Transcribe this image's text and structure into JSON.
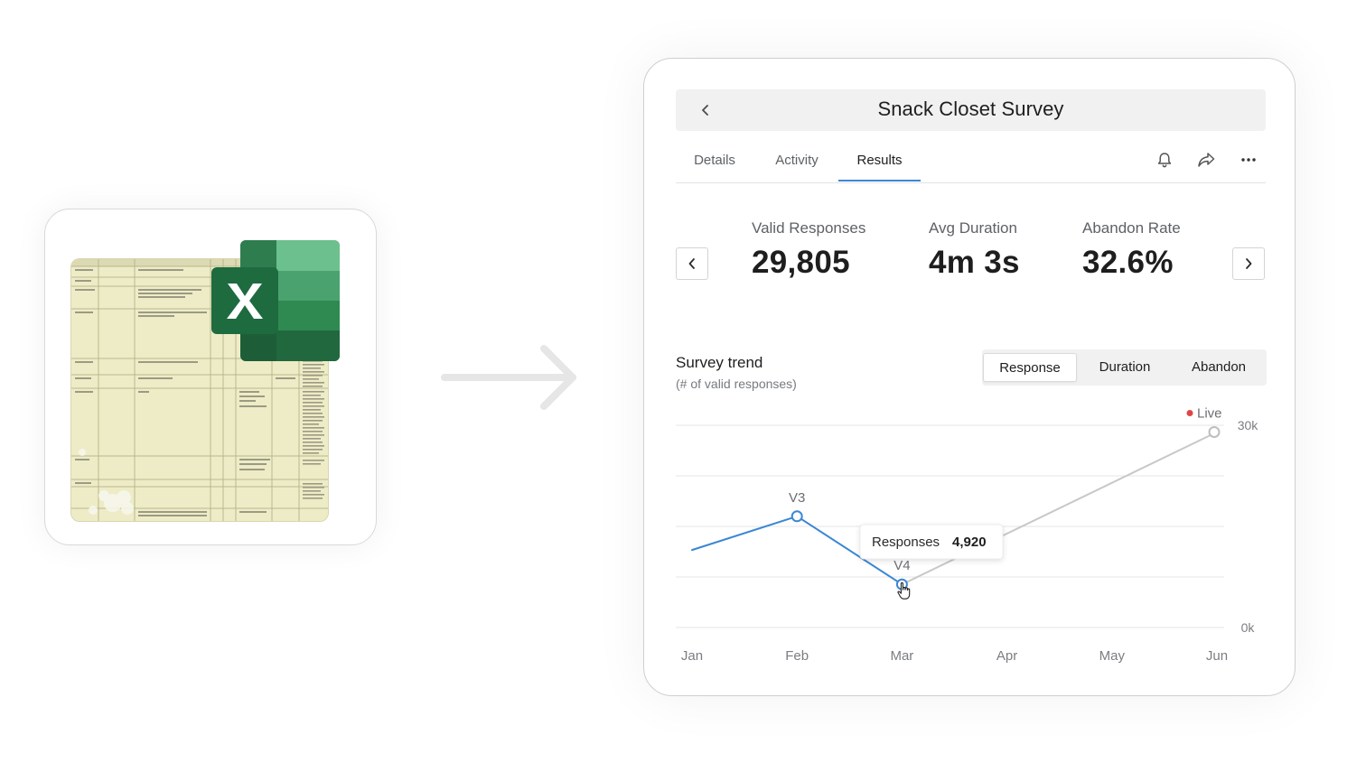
{
  "panel": {
    "title": "Snack Closet Survey",
    "tabs": [
      {
        "label": "Details",
        "active": false
      },
      {
        "label": "Activity",
        "active": false
      },
      {
        "label": "Results",
        "active": true
      }
    ],
    "icons": [
      "chevron-left-icon",
      "bell-icon",
      "share-icon",
      "more-icon",
      "chevron-left-icon",
      "chevron-right-icon"
    ],
    "accent_color": "#3b86d4"
  },
  "stats": [
    {
      "label": "Valid Responses",
      "value": "29,805"
    },
    {
      "label": "Avg Duration",
      "value": "4m 3s"
    },
    {
      "label": "Abandon Rate",
      "value": "32.6%"
    }
  ],
  "trend": {
    "title": "Survey trend",
    "subtitle": "(# of valid responses)",
    "segments": [
      {
        "label": "Response",
        "active": true
      },
      {
        "label": "Duration",
        "active": false
      },
      {
        "label": "Abandon",
        "active": false
      }
    ],
    "tooltip": {
      "label": "Responses",
      "value": "4,920"
    }
  },
  "chart_data": {
    "type": "line",
    "x": [
      "Jan",
      "Feb",
      "Mar",
      "Apr",
      "May",
      "Jun"
    ],
    "y_ticks": [
      "30k",
      "0k"
    ],
    "ylim": [
      0,
      30000
    ],
    "grid": true,
    "series": [
      {
        "values": [
          11500,
          16500,
          null,
          null,
          null,
          null
        ],
        "color": "#3b86d4"
      },
      {
        "values": [
          null,
          16500,
          6400,
          null,
          null,
          null
        ],
        "color": "#3b86d4"
      },
      {
        "values": [
          null,
          null,
          6400,
          null,
          null,
          29000
        ],
        "color": "#c8c8c8"
      }
    ],
    "annotations": [
      {
        "x": "Feb",
        "y": 16500,
        "text": "V3"
      },
      {
        "x": "Mar",
        "y": 6400,
        "text": "V4"
      },
      {
        "x": "Jun",
        "y": 29000,
        "text": "Live"
      }
    ]
  }
}
